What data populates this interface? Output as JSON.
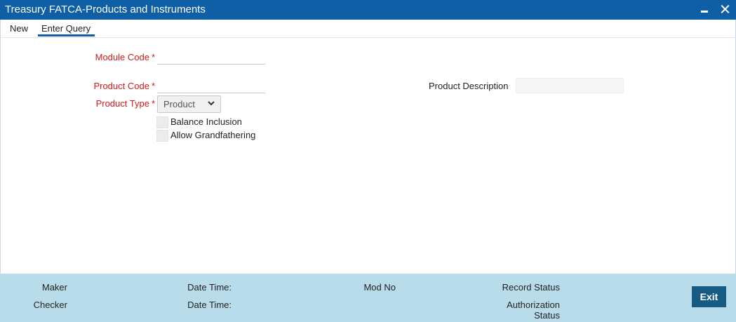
{
  "window": {
    "title": "Treasury FATCA-Products and Instruments"
  },
  "toolbar": {
    "new_label": "New",
    "enter_query_label": "Enter Query"
  },
  "form": {
    "module_code": {
      "label": "Module Code",
      "required_mark": "*",
      "value": ""
    },
    "product_code": {
      "label": "Product Code",
      "required_mark": "*",
      "value": ""
    },
    "product_description": {
      "label": "Product Description",
      "value": ""
    },
    "product_type": {
      "label": "Product Type",
      "required_mark": "*",
      "selected": "Product"
    },
    "balance_inclusion": {
      "label": "Balance Inclusion",
      "checked": false
    },
    "allow_grandfathering": {
      "label": "Allow Grandfathering",
      "checked": false
    }
  },
  "footer": {
    "maker_label": "Maker",
    "checker_label": "Checker",
    "date_time_label_1": "Date Time:",
    "date_time_label_2": "Date Time:",
    "mod_no_label": "Mod No",
    "record_status_label": "Record Status",
    "authorization_label_line1": "Authorization",
    "authorization_label_line2": "Status",
    "exit_label": "Exit"
  },
  "colors": {
    "titlebar": "#0e5fa6",
    "required_label": "#d01919",
    "footer_bg": "#b9dcea",
    "exit_button": "#175a82"
  }
}
